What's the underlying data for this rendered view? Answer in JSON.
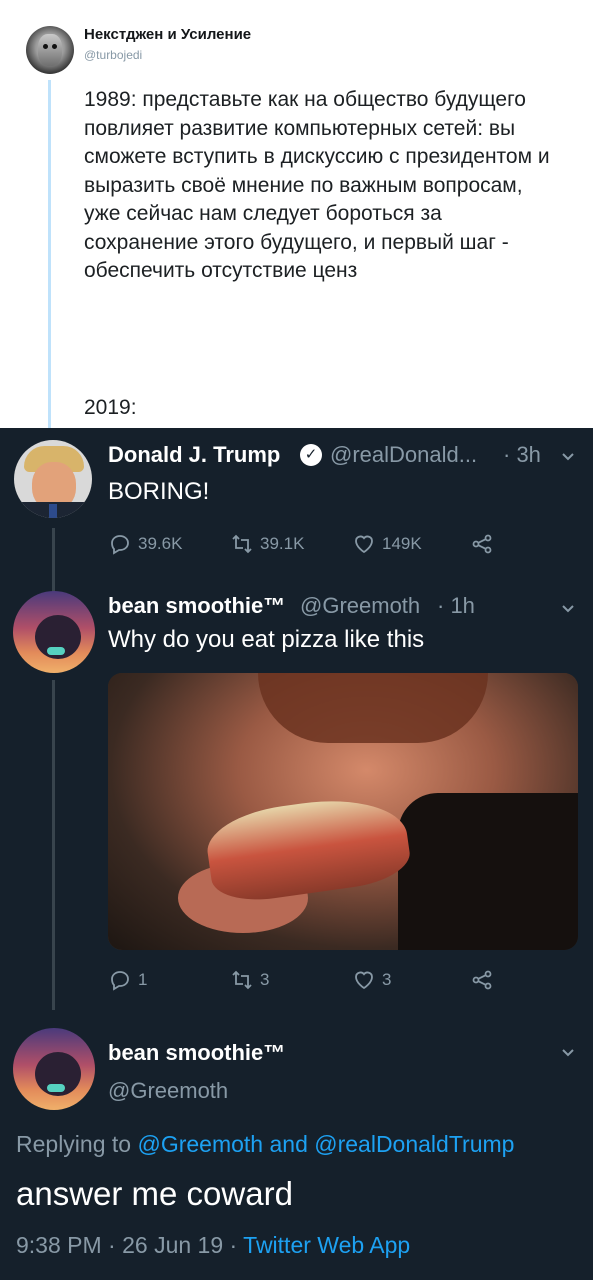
{
  "top_tweet": {
    "name": "Некстджен и Усиление",
    "handle": "@turbojedi",
    "body": "1989: представьте как на общество будущего повлияет развитие компьютерных сетей: вы сможете вступить в дискуссию с президентом и выразить своё мнение по важным вопросам, уже сейчас нам следует бороться за сохранение этого будущего, и первый шаг - обеспечить отсутствие ценз",
    "body2": "2019:"
  },
  "tweet1": {
    "name": "Donald J. Trump",
    "handle": "@realDonald...",
    "time": "· 3h",
    "text": "BORING!",
    "replies": "39.6K",
    "retweets": "39.1K",
    "likes": "149K"
  },
  "tweet2": {
    "name": "bean smoothie™",
    "handle": "@Greemoth",
    "time": "· 1h",
    "text": "Why do you eat pizza like this",
    "replies": "1",
    "retweets": "3",
    "likes": "3"
  },
  "tweet3": {
    "name": "bean smoothie™",
    "handle": "@Greemoth",
    "replying_prefix": "Replying to",
    "reply_to_1": "@Greemoth",
    "reply_and": "and",
    "reply_to_2": "@realDonaldTrump",
    "text": "answer me coward",
    "timestamp": "9:38 PM · 26 Jun 19 ·",
    "source": "Twitter Web App"
  },
  "colors": {
    "dark_bg": "#15202b",
    "muted": "#8899a6",
    "link": "#1da1f2"
  }
}
